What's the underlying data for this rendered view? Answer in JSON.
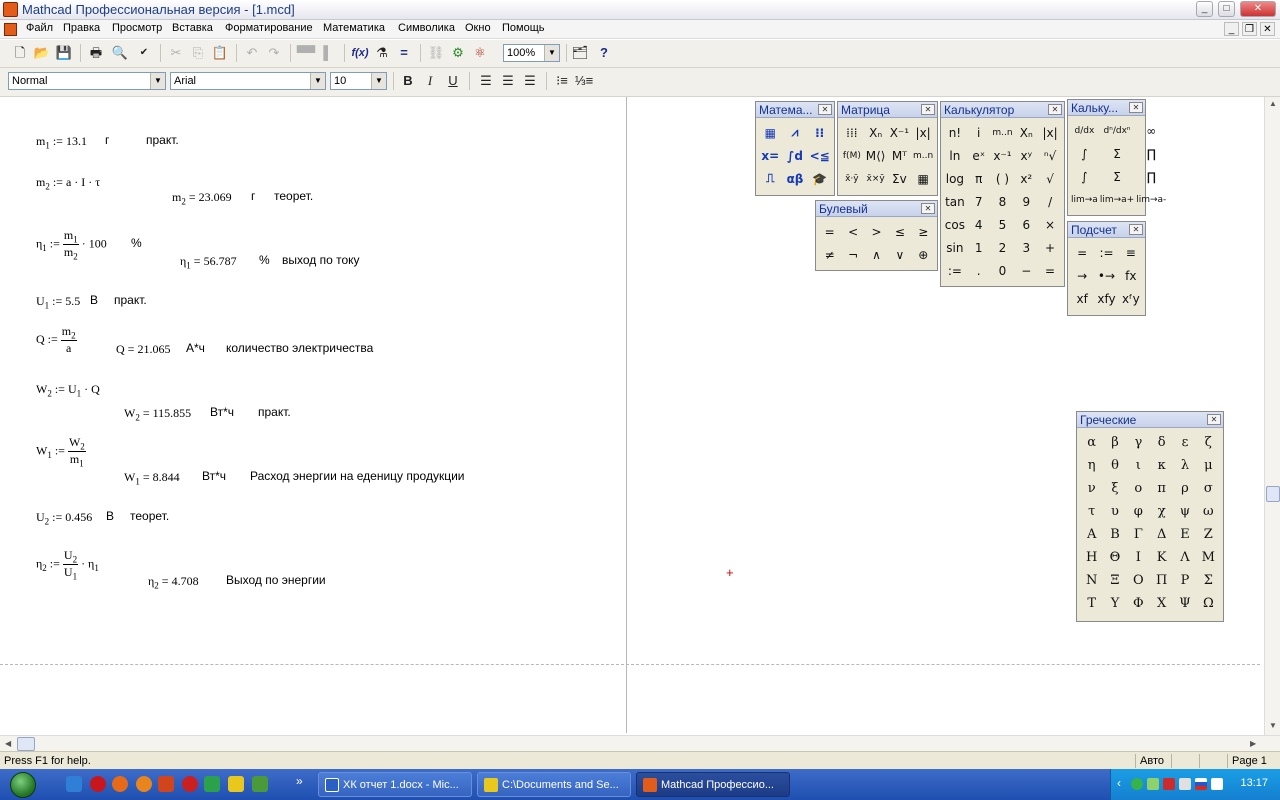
{
  "window": {
    "title": "Mathcad Профессиональная версия - [1.mcd]"
  },
  "menu": {
    "items": [
      "Файл",
      "Правка",
      "Просмотр",
      "Вставка",
      "Форматирование",
      "Математика",
      "Символика",
      "Окно",
      "Помощь"
    ]
  },
  "toolbar": {
    "zoom": "100%"
  },
  "format": {
    "style": "Normal",
    "font": "Arial",
    "size": "10"
  },
  "doc": {
    "r1": {
      "lhs": "m",
      "sub": "1",
      "op": " := ",
      "rhs": "13.1",
      "unit": "г",
      "note": "практ."
    },
    "r2": {
      "lhs": "m",
      "sub": "2",
      "op": " := ",
      "rhs": "a · I · τ"
    },
    "r2res": {
      "lhs": "m",
      "sub": "2",
      "op": " = ",
      "rhs": "23.069",
      "unit": "г",
      "note": "теорет."
    },
    "r3": {
      "lhs": "η",
      "sub": "1",
      "op": " := ",
      "num_v": "m",
      "num_s": "1",
      "den_v": "m",
      "den_s": "2",
      "tail": " · 100",
      "unit": "%"
    },
    "r3res": {
      "lhs": "η",
      "sub": "1",
      "op": " = ",
      "rhs": "56.787",
      "unit": "%",
      "note": "выход по току"
    },
    "r4": {
      "lhs": "U",
      "sub": "1",
      "op": " := ",
      "rhs": "5.5",
      "unit": "В",
      "note": "практ."
    },
    "r5": {
      "lhs": "Q",
      "op": " := ",
      "num_v": "m",
      "num_s": "2",
      "den_v": "a"
    },
    "r5res": {
      "lhs": "Q",
      "op": " = ",
      "rhs": "21.065",
      "unit": "А*ч",
      "note": "количество электричества"
    },
    "r6": {
      "lhs": "W",
      "sub": "2",
      "op": " := ",
      "a": "U",
      "a_s": "1",
      "b": " · Q"
    },
    "r6res": {
      "lhs": "W",
      "sub": "2",
      "op": " = ",
      "rhs": "115.855",
      "unit": "Вт*ч",
      "note": "практ."
    },
    "r7": {
      "lhs": "W",
      "sub": "1",
      "op": " := ",
      "num_v": "W",
      "num_s": "2",
      "den_v": "m",
      "den_s": "1"
    },
    "r7res": {
      "lhs": "W",
      "sub": "1",
      "op": " = ",
      "rhs": "8.844",
      "unit": "Вт*ч",
      "note": "Расход энергии на еденицу продукции"
    },
    "r8": {
      "lhs": "U",
      "sub": "2",
      "op": " := ",
      "rhs": "0.456",
      "unit": "В",
      "note": "теорет."
    },
    "r9": {
      "lhs": "η",
      "sub": "2",
      "op": " := ",
      "num_v": "U",
      "num_s": "2",
      "den_v": "U",
      "den_s": "1",
      "tail_v": " · η",
      "tail_s": "1"
    },
    "r9res": {
      "lhs": "η",
      "sub": "2",
      "op": " = ",
      "rhs": "4.708",
      "note": "Выход по энергии"
    }
  },
  "palettes": {
    "math": {
      "title": "Матема...",
      "buttons": [
        "▦",
        "⩘",
        "⁝⁝",
        "x=",
        "∫d",
        "<≦",
        "⎍",
        "αβ",
        "🎓"
      ]
    },
    "matrix": {
      "title": "Матрица",
      "buttons": [
        "⁞⁞⁞",
        "Xₙ",
        "X⁻¹",
        "|x|",
        "f(M)",
        "M⟨⟩",
        "Mᵀ",
        "m..n",
        "x̄·ȳ",
        "x̄×ȳ",
        "Σv",
        "▦"
      ]
    },
    "calc": {
      "title": "Калькулятор",
      "buttons": [
        "n!",
        "i",
        "m..n",
        "Xₙ",
        "|x|",
        "ln",
        "eˣ",
        "x⁻¹",
        "xʸ",
        "ⁿ√",
        "log",
        "π",
        "( )",
        "x²",
        "√",
        "tan",
        "7",
        "8",
        "9",
        "/",
        "cos",
        "4",
        "5",
        "6",
        "×",
        "sin",
        "1",
        "2",
        "3",
        "+",
        ":=",
        ".",
        "0",
        "−",
        "="
      ]
    },
    "calc2": {
      "title": "Кальку...",
      "buttons": [
        "d/dx",
        "dⁿ/dxⁿ",
        "∞",
        "∫",
        "Σ",
        "∏",
        "∫",
        "Σ",
        "∏",
        "lim→a",
        "lim→a+",
        "lim→a-"
      ]
    },
    "bool": {
      "title": "Булевый",
      "buttons": [
        "=",
        "<",
        ">",
        "≤",
        "≥",
        "≠",
        "¬",
        "∧",
        "∨",
        "⊕"
      ]
    },
    "eval": {
      "title": "Подсчет",
      "buttons": [
        "=",
        ":=",
        "≡",
        "→",
        "•→",
        "fx",
        "xf",
        "xfy",
        "xᶠy"
      ]
    },
    "greek": {
      "title": "Греческие",
      "buttons": [
        "α",
        "β",
        "γ",
        "δ",
        "ε",
        "ζ",
        "η",
        "θ",
        "ι",
        "κ",
        "λ",
        "μ",
        "ν",
        "ξ",
        "ο",
        "π",
        "ρ",
        "σ",
        "τ",
        "υ",
        "φ",
        "χ",
        "ψ",
        "ω",
        "Α",
        "Β",
        "Γ",
        "Δ",
        "Ε",
        "Ζ",
        "Η",
        "Θ",
        "Ι",
        "Κ",
        "Λ",
        "Μ",
        "Ν",
        "Ξ",
        "Ο",
        "Π",
        "Ρ",
        "Σ",
        "Τ",
        "Υ",
        "Φ",
        "Χ",
        "Ψ",
        "Ω"
      ]
    }
  },
  "status": {
    "help": "Press F1 for help.",
    "mode": "Авто",
    "page": "Page 1"
  },
  "taskbar": {
    "tasks": [
      "ХК отчет 1.docx - Mic...",
      "C:\\Documents and Se...",
      "Mathcad Профессио..."
    ],
    "clock": "13:17",
    "overflow": "»"
  }
}
